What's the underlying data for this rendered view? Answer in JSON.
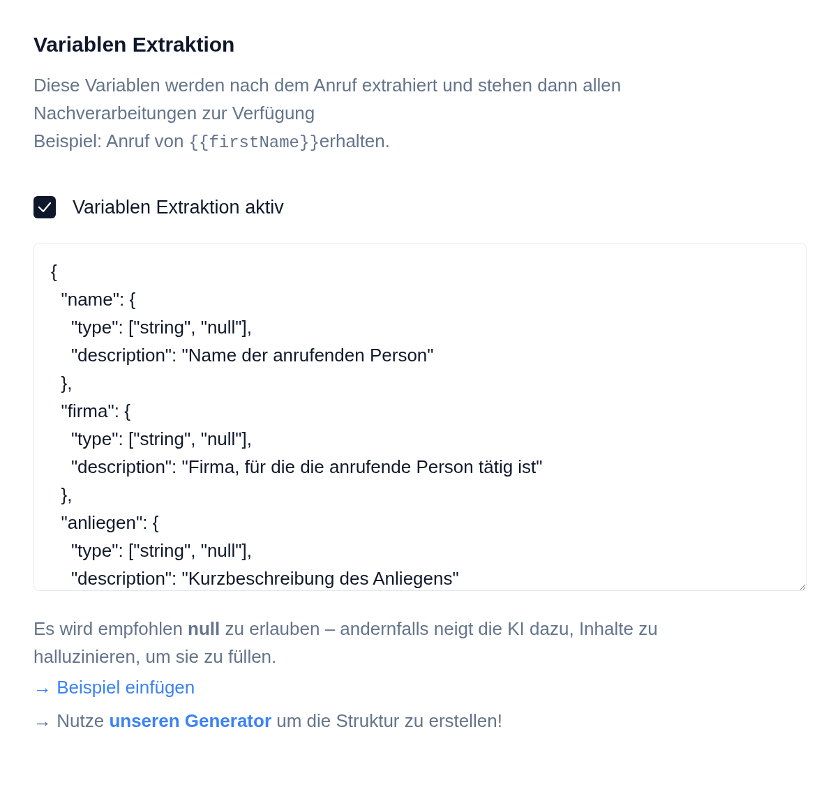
{
  "section": {
    "title": "Variablen Extraktion",
    "description": "Diese Variablen werden nach dem Anruf extrahiert und stehen dann allen Nachverarbeitungen zur Verfügung",
    "example": {
      "prefix": "Beispiel: Anruf von ",
      "code": "{{firstName}}",
      "suffix": "erhalten."
    }
  },
  "toggle": {
    "label": "Variablen Extraktion aktiv",
    "checked": true
  },
  "schema_editor": {
    "value": "{\n  \"name\": {\n    \"type\": [\"string\", \"null\"],\n    \"description\": \"Name der anrufenden Person\"\n  },\n  \"firma\": {\n    \"type\": [\"string\", \"null\"],\n    \"description\": \"Firma, für die die anrufende Person tätig ist\"\n  },\n  \"anliegen\": {\n    \"type\": [\"string\", \"null\"],\n    \"description\": \"Kurzbeschreibung des Anliegens\""
  },
  "hint": "Es wird empfohlen **null** zu erlauben – andernfalls neigt die KI dazu, Inhalte zu halluzinieren, um sie zu füllen.",
  "insert_example_link": "→ Beispiel einfügen",
  "generator_hint": {
    "prefix": "→ Nutze ",
    "link": "unseren Generator",
    "suffix": " um die Struktur zu erstellen!"
  }
}
